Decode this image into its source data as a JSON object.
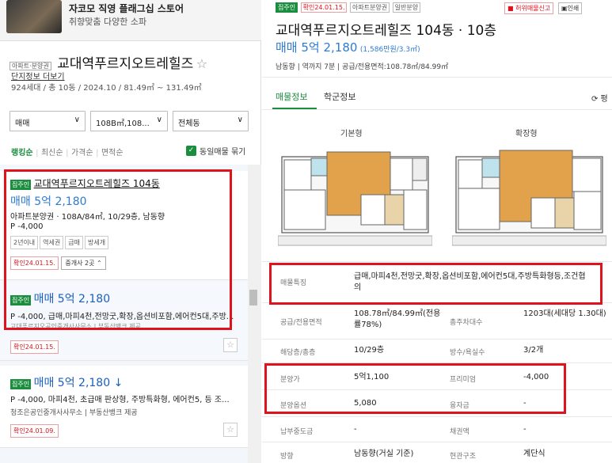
{
  "ad": {
    "title": "자코모 직영 플래그십 스토어",
    "subtitle": "취향맞춤 다양한 소파"
  },
  "complex": {
    "tag": "아파트·분양권",
    "name": "교대역푸르지오트레힐즈",
    "star": "☆",
    "info_link": "단지정보 더보기",
    "meta": "924세대 / 총 10동 / 2024.10 / 81.49㎡ ~ 131.49㎡"
  },
  "filters": [
    {
      "value": "매매",
      "chev": "∨"
    },
    {
      "value": "108B㎡,108...",
      "chev": "∨"
    },
    {
      "value": "전체동",
      "chev": "∨"
    }
  ],
  "sort": {
    "options": [
      "랭킹순",
      "최신순",
      "가격순",
      "면적순"
    ],
    "active": "랭킹순",
    "same_listing_label": "동일매물 묶기",
    "checked": "✓"
  },
  "listings": [
    {
      "badge": "집주인",
      "title": "교대역푸르지오트레힐즈 104동",
      "price": "매매 5억 2,180",
      "desc1": "아파트분양권 · 108A/84㎡, 10/29층, 남동향",
      "desc2": "P -4,000",
      "tags": [
        "2년이내",
        "역세권",
        "급매",
        "방세개"
      ],
      "confirm": "확인24.01.15.",
      "brokers": "중개사 2곳 ⌃"
    },
    {
      "badge": "집주인",
      "price": "매매 5억 2,180",
      "desc1": "P -4,000, 급매,마피4천,전망굿,확장,옵션비포함,에어컨5대,주방...",
      "desc2": "교대푸르지오공인중개사사무소 | 부동산뱅크 제공",
      "confirm": "확인24.01.15."
    },
    {
      "badge": "집주인",
      "price": "매매 5억 2,180 ↓",
      "desc1": "P -4,000, 마피4천, 초급매 판상형, 주방특화형, 에어컨5, 등 조...",
      "desc2": "청조은공인중개사사무소 | 부동산뱅크 제공",
      "confirm": "확인24.01.09."
    }
  ],
  "detail": {
    "tags": [
      {
        "label": "집주인",
        "type": "green"
      },
      {
        "label": "확인24.01.15.",
        "type": "red"
      },
      {
        "label": "아파트분양권",
        "type": "plain"
      },
      {
        "label": "일반분양",
        "type": "plain"
      }
    ],
    "report_btn": "허위매물신고",
    "print_btn": "인쇄",
    "title": "교대역푸르지오트레힐즈 104동 · 10층",
    "price": "매매 5억 2,180",
    "price_sub": "(1,586만원/3.3㎡)",
    "meta": "남동향 | 역까지 7분 | 공급/전용면적:108.78㎡/84.99㎡",
    "tabs": [
      "매물정보",
      "학군정보"
    ],
    "active_tab": "매물정보",
    "refresh": "⟳ 평",
    "floorplans": [
      "기본형",
      "확장형"
    ],
    "rows": [
      {
        "label": "매물특징",
        "value": "급매,마피4천,전망굿,확장,옵션비포함,에어컨5대,주방특화형등,조건협의"
      },
      {
        "label": "공급/전용면적",
        "value": "108.78㎡/84.99㎡(전용률78%)",
        "label2": "총주차대수",
        "value2": "1203대(세대당 1.30대)"
      },
      {
        "label": "해당층/총층",
        "value": "10/29층",
        "label2": "방수/욕실수",
        "value2": "3/2개"
      },
      {
        "label": "분양가",
        "value": "5억1,100",
        "label2": "프리미엄",
        "value2": "-4,000"
      },
      {
        "label": "분양옵션",
        "value": "5,080",
        "label2": "융자금",
        "value2": "-"
      },
      {
        "label": "납부중도금",
        "value": "-",
        "label2": "채권액",
        "value2": "-"
      },
      {
        "label": "방향",
        "value": "남동향(거실 기준)",
        "label2": "현관구조",
        "value2": "계단식"
      }
    ]
  },
  "colors": {
    "accent_green": "#1b8d3e",
    "price_blue": "#2d7bd3",
    "highlight_red": "#e0121b"
  }
}
